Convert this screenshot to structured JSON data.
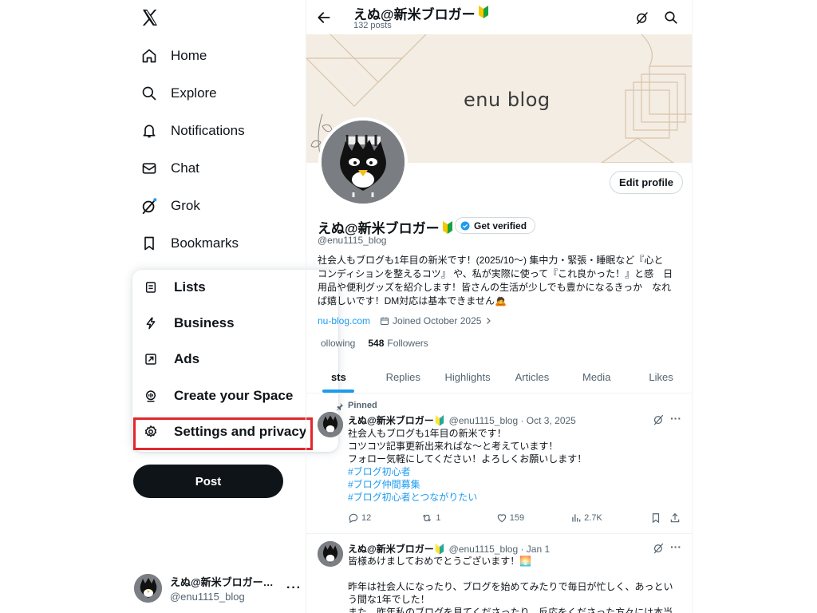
{
  "nav": {
    "items": [
      {
        "label": "Home",
        "icon": "home-icon"
      },
      {
        "label": "Explore",
        "icon": "search-icon"
      },
      {
        "label": "Notifications",
        "icon": "bell-icon"
      },
      {
        "label": "Chat",
        "icon": "mail-icon"
      },
      {
        "label": "Grok",
        "icon": "grok-icon"
      },
      {
        "label": "Bookmarks",
        "icon": "bookmark-icon"
      }
    ],
    "post_label": "Post"
  },
  "more_menu": {
    "items": [
      {
        "label": "Lists",
        "icon": "list-icon"
      },
      {
        "label": "Business",
        "icon": "lightning-icon"
      },
      {
        "label": "Ads",
        "icon": "ads-arrow-icon"
      },
      {
        "label": "Create your Space",
        "icon": "space-mic-icon"
      },
      {
        "label": "Settings and privacy",
        "icon": "gear-icon"
      }
    ],
    "highlight_color": "#e0282e"
  },
  "account": {
    "name": "えぬ@新米ブロガー…",
    "handle": "@enu1115_blog",
    "more": "···"
  },
  "header": {
    "title": "えぬ@新米ブロガー",
    "posts_count": "132 posts"
  },
  "banner": {
    "text": "enu blog"
  },
  "profile": {
    "name": "えぬ@新米ブロガー",
    "get_verified": "Get verified",
    "handle": "@enu1115_blog",
    "edit_profile": "Edit profile",
    "bio": "社会人もブログも1年目の新米です！(2025/10〜)  集中力・緊張・睡眠など『心と　コンディションを整えるコツ』 や、私が実際に使って『これ良かった！』と感　日用品や便利グッズを紹介します！皆さんの生活が少しでも豊かになるきっか　なれば嬉しいです！DM対応は基本できません🙇",
    "website": "nu-blog.com",
    "joined": "Joined October 2025",
    "following_count": "",
    "following_label": "ollowing",
    "followers_count": "548",
    "followers_label": "Followers"
  },
  "tabs": [
    "sts",
    "Replies",
    "Highlights",
    "Articles",
    "Media",
    "Likes"
  ],
  "tweets": [
    {
      "pinned_label": "Pinned",
      "name": "えぬ@新米ブロガー🔰",
      "meta": "@enu1115_blog · Oct 3, 2025",
      "lines": [
        "社会人もブログも1年目の新米です！",
        "コツコツ記事更新出来ればな〜と考えています！",
        "フォロー気軽にしてください！よろしくお願いします！"
      ],
      "tags": [
        "#ブログ初心者",
        "#ブログ仲間募集",
        "#ブログ初心者とつながりたい"
      ],
      "replies": "12",
      "reposts": "1",
      "likes": "159",
      "views": "2.7K"
    },
    {
      "name": "えぬ@新米ブロガー🔰",
      "meta": "@enu1115_blog · Jan 1",
      "lines": [
        "皆様あけましておめでとうございます！🌅",
        "",
        "昨年は社会人になったり、ブログを始めてみたりで毎日が忙しく、あっとい",
        "う間な1年でした！",
        "また、昨年私のブログを見てくださったり、反応をくださった方々には本当"
      ]
    }
  ],
  "colors": {
    "accent": "#1d9bf0",
    "text": "#0f1419",
    "muted": "#536471",
    "banner_bg": "#f4ede4"
  }
}
